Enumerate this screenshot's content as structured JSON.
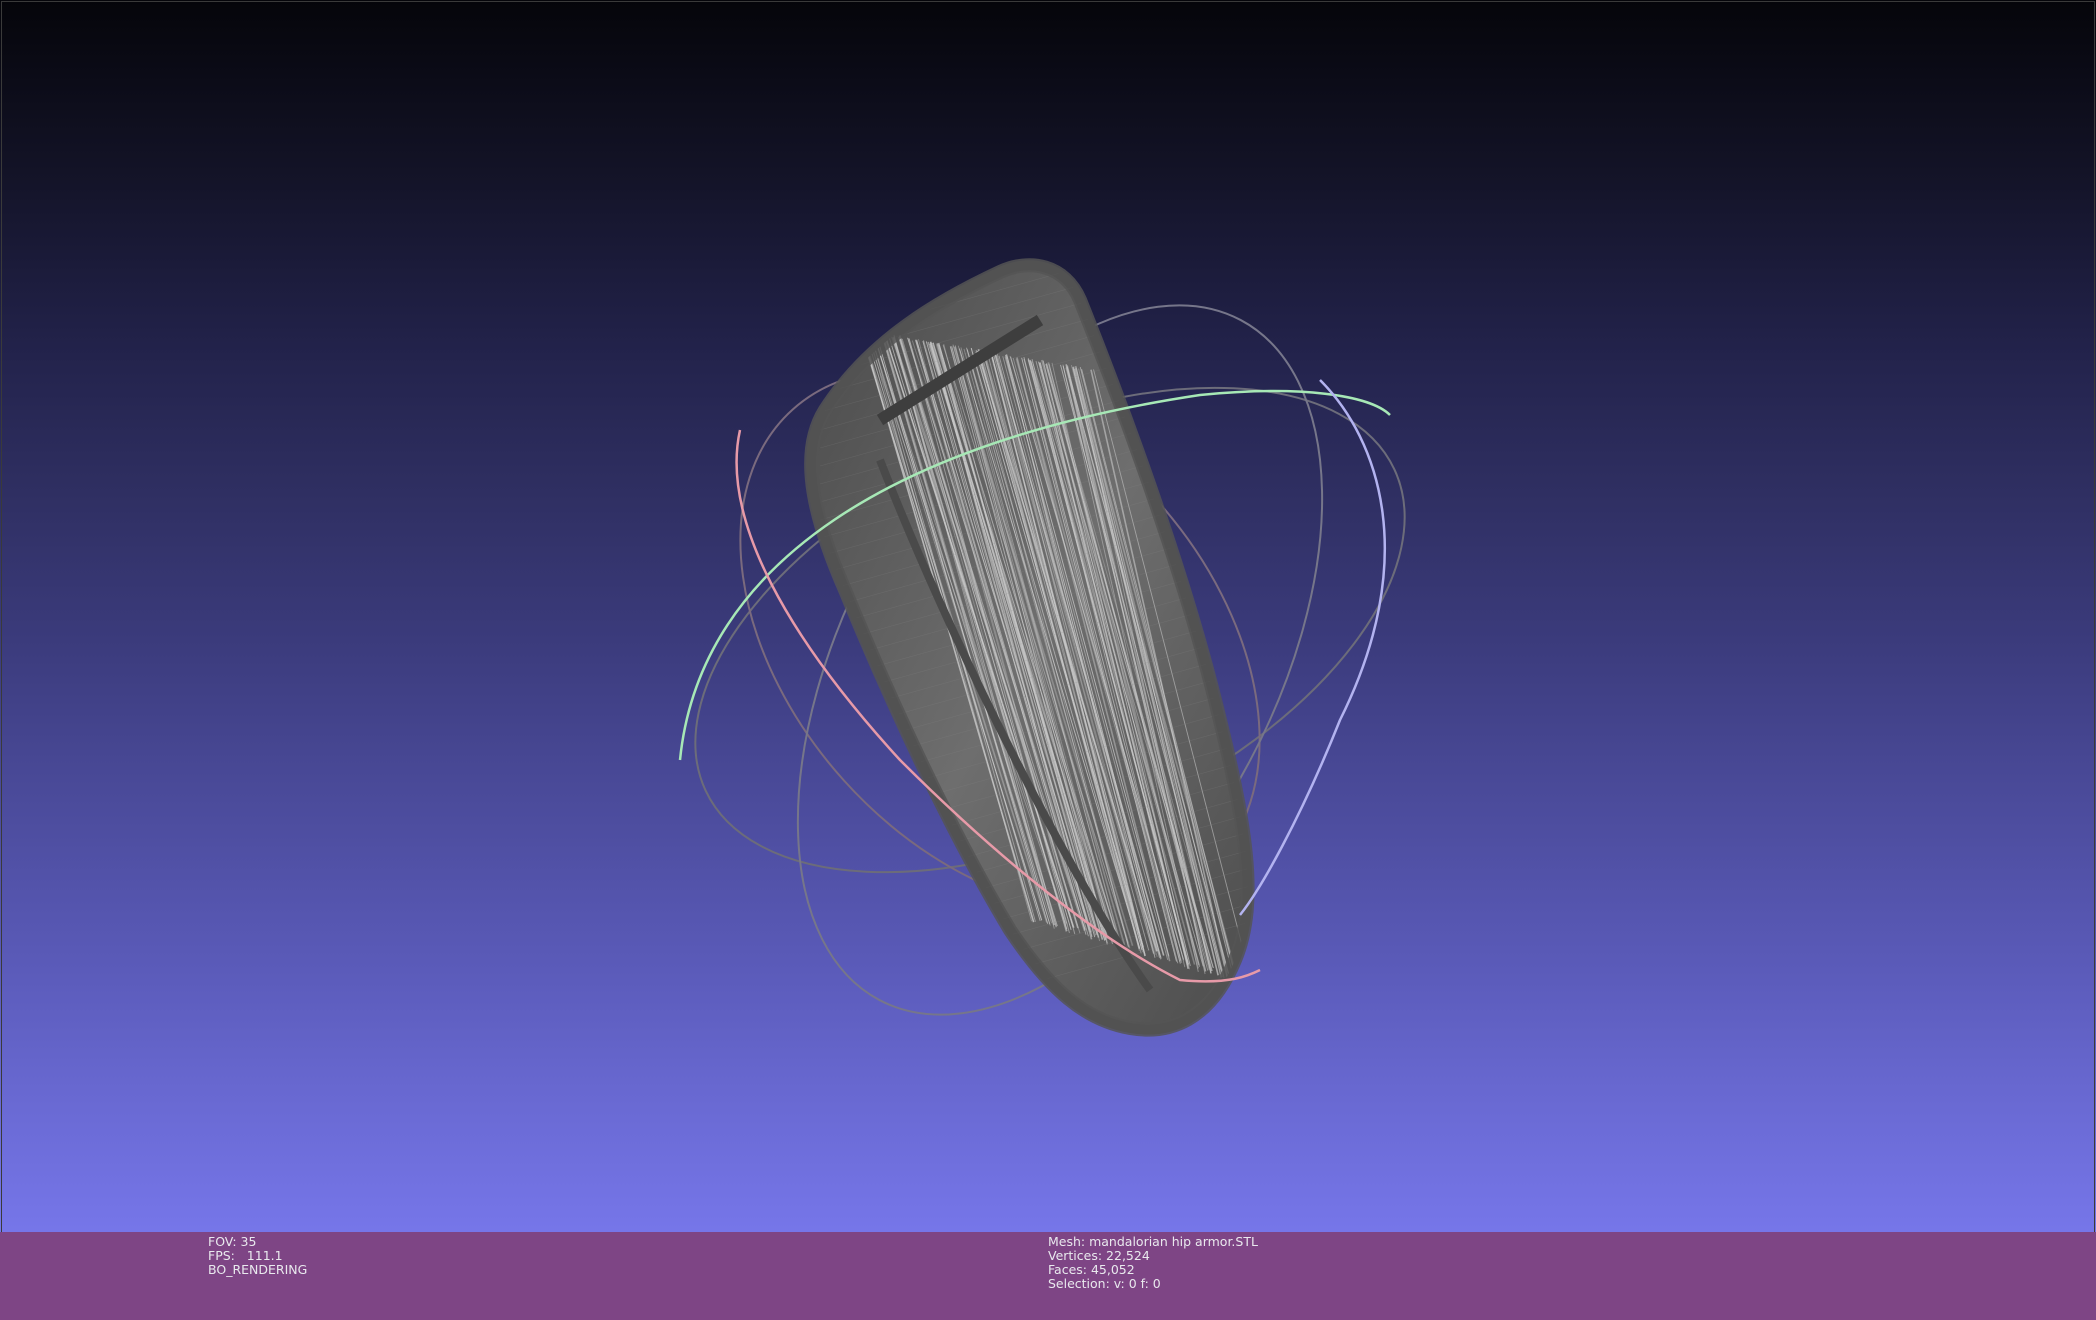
{
  "viewport": {
    "background_top": "#05050a",
    "background_bottom": "#7676e9",
    "mesh_color": "#5a5a5a",
    "mesh_highlight": "#c8c8c8",
    "trackball": {
      "x_ring_color": "#e88a9a",
      "y_ring_color": "#9fe6b0",
      "z_ring_color": "#a8a8ee",
      "ring_shadow_color": "#6a6a6a"
    }
  },
  "status_bar": {
    "background": "#7e4585",
    "left": {
      "fov": "FOV: 35",
      "fps": "FPS:   111.1",
      "render_mode": "BO_RENDERING"
    },
    "right": {
      "mesh": "Mesh: mandalorian hip armor.STL",
      "vertices": "Vertices: 22,524",
      "faces": "Faces: 45,052",
      "selection": "Selection: v: 0 f: 0"
    }
  }
}
